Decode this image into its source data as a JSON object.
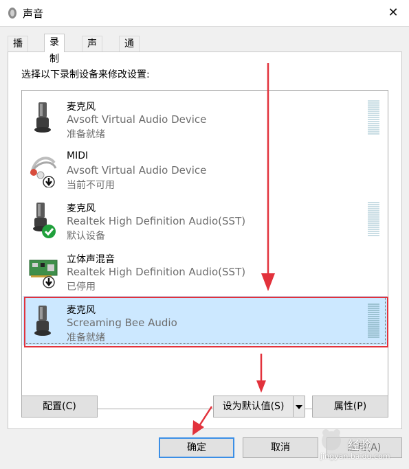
{
  "window": {
    "title": "声音",
    "close_glyph": "✕"
  },
  "tabs": [
    {
      "label": "播放",
      "active": false
    },
    {
      "label": "录制",
      "active": true
    },
    {
      "label": "声音",
      "active": false
    },
    {
      "label": "通信",
      "active": false
    }
  ],
  "instruction": "选择以下录制设备来修改设置:",
  "devices": [
    {
      "name": "麦克风",
      "driver": "Avsoft Virtual Audio Device",
      "status": "准备就绪",
      "icon": "microphone-icon"
    },
    {
      "name": "MIDI",
      "driver": "Avsoft Virtual Audio Device",
      "status": "当前不可用",
      "icon": "cable-icon",
      "badge": "down-arrow-badge"
    },
    {
      "name": "麦克风",
      "driver": "Realtek High Definition Audio(SST)",
      "status": "默认设备",
      "icon": "microphone-icon",
      "badge": "check-badge"
    },
    {
      "name": "立体声混音",
      "driver": "Realtek High Definition Audio(SST)",
      "status": "已停用",
      "icon": "sound-card-icon",
      "badge": "down-arrow-badge"
    },
    {
      "name": "麦克风",
      "driver": "Screaming Bee Audio",
      "status": "准备就绪",
      "icon": "microphone-icon",
      "selected": true
    }
  ],
  "buttons": {
    "configure": "配置(C)",
    "set_default": "设为默认值(S)",
    "properties": "属性(P)",
    "ok": "确定",
    "cancel": "取消",
    "apply": "应用(A)"
  },
  "watermark": {
    "text": "经验",
    "url": "jingyan.baidu.com"
  },
  "colors": {
    "annotation": "#e2323c",
    "selection": "#cce8ff",
    "default_btn_border": "#3a8ee6"
  }
}
